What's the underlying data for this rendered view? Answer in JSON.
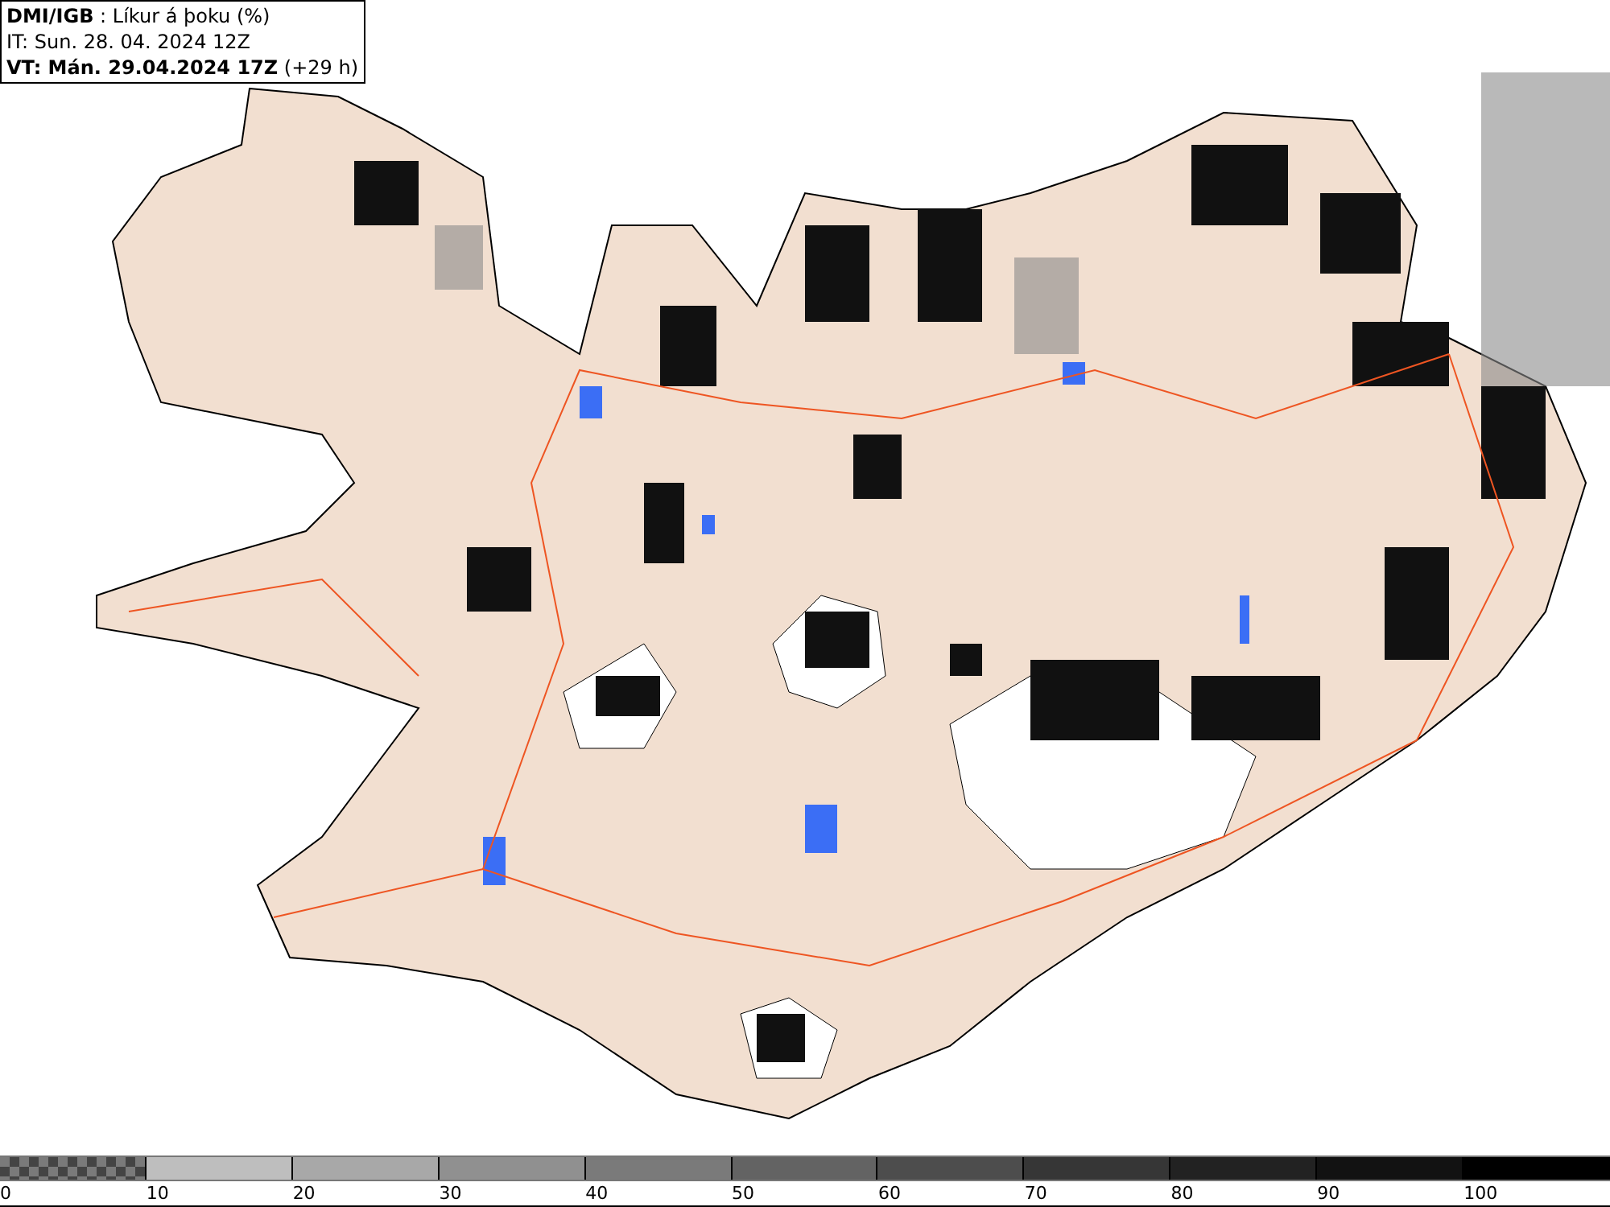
{
  "header": {
    "title": "**DMI/IGB** : Líkur á þoku (%)",
    "issue_time": "IT: Sun. 28. 04. 2024 12Z",
    "valid_time": "**VT: Mán. 29.04.2024 17Z** (+29 h)"
  },
  "legend": {
    "segments": [
      {
        "kind": "checker"
      },
      {
        "kind": "solid",
        "color": "#bebebe"
      },
      {
        "kind": "solid",
        "color": "#a8a8a8"
      },
      {
        "kind": "solid",
        "color": "#909090"
      },
      {
        "kind": "solid",
        "color": "#7a7a7a"
      },
      {
        "kind": "solid",
        "color": "#636363"
      },
      {
        "kind": "solid",
        "color": "#4d4d4d"
      },
      {
        "kind": "solid",
        "color": "#363636"
      },
      {
        "kind": "solid",
        "color": "#222222"
      },
      {
        "kind": "solid",
        "color": "#121212"
      },
      {
        "kind": "solid",
        "color": "#000000"
      }
    ],
    "tick_labels": [
      "0",
      "10",
      "20",
      "30",
      "40",
      "50",
      "60",
      "70",
      "80",
      "90",
      "100"
    ]
  }
}
